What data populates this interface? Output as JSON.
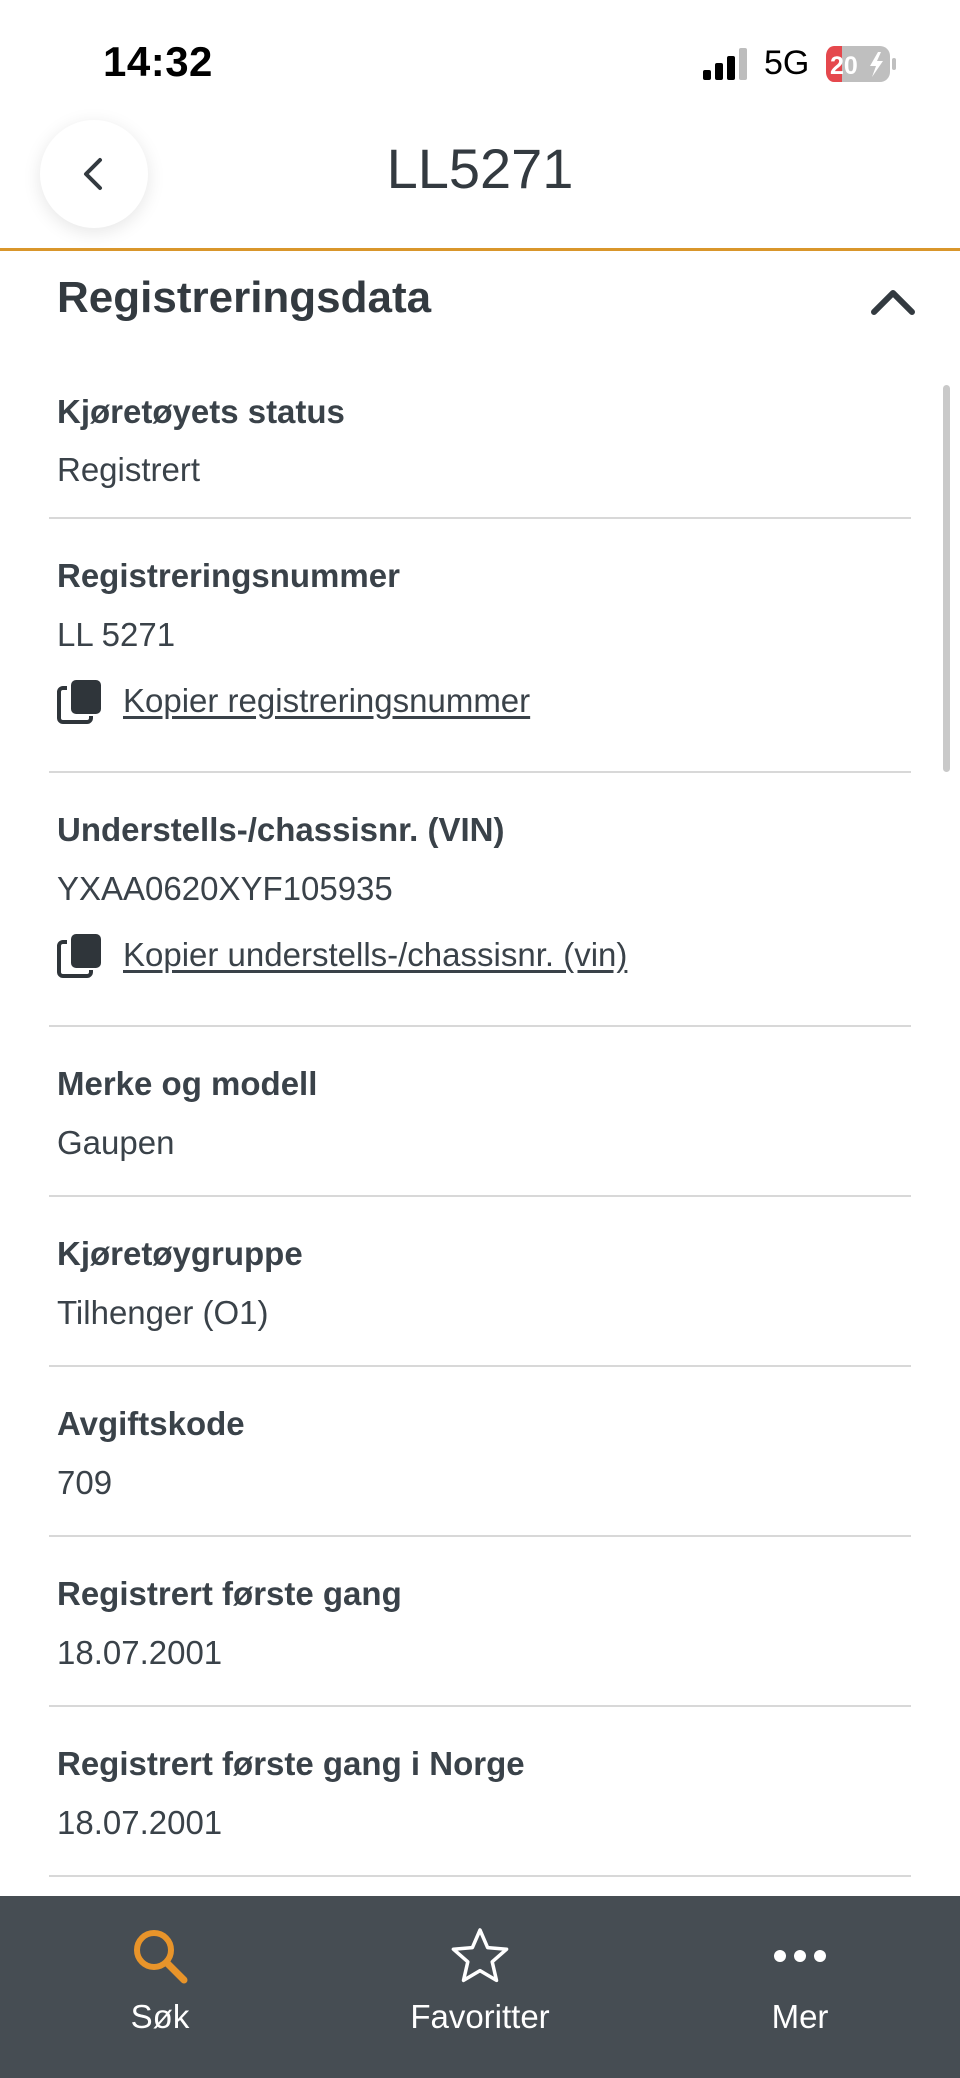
{
  "status_bar": {
    "time": "14:32",
    "network": "5G",
    "battery": "20"
  },
  "header": {
    "title": "LL5271"
  },
  "section": {
    "title": "Registreringsdata"
  },
  "fields": [
    {
      "label": "Kjøretøyets status",
      "value": "Registrert"
    },
    {
      "label": "Registreringsnummer",
      "value": "LL 5271",
      "copy_label": "Kopier registreringsnummer"
    },
    {
      "label": "Understells-/chassisnr. (VIN)",
      "value": "YXAA0620XYF105935",
      "copy_label": "Kopier understells-/chassisnr. (vin)"
    },
    {
      "label": "Merke og modell",
      "value": "Gaupen"
    },
    {
      "label": "Kjøretøygruppe",
      "value": "Tilhenger (O1)"
    },
    {
      "label": "Avgiftskode",
      "value": "709"
    },
    {
      "label": "Registrert første gang",
      "value": "18.07.2001"
    },
    {
      "label": "Registrert første gang i Norge",
      "value": "18.07.2001"
    }
  ],
  "tabs": [
    {
      "label": "Søk",
      "icon": "search-icon",
      "active": true
    },
    {
      "label": "Favoritter",
      "icon": "star-icon",
      "active": false
    },
    {
      "label": "Mer",
      "icon": "more-icon",
      "active": false
    }
  ],
  "colors": {
    "accent": "#d9962b",
    "tab_bar": "#464d53",
    "text": "#333a40",
    "divider": "#d8d8d8",
    "battery_low": "#e5484d"
  }
}
